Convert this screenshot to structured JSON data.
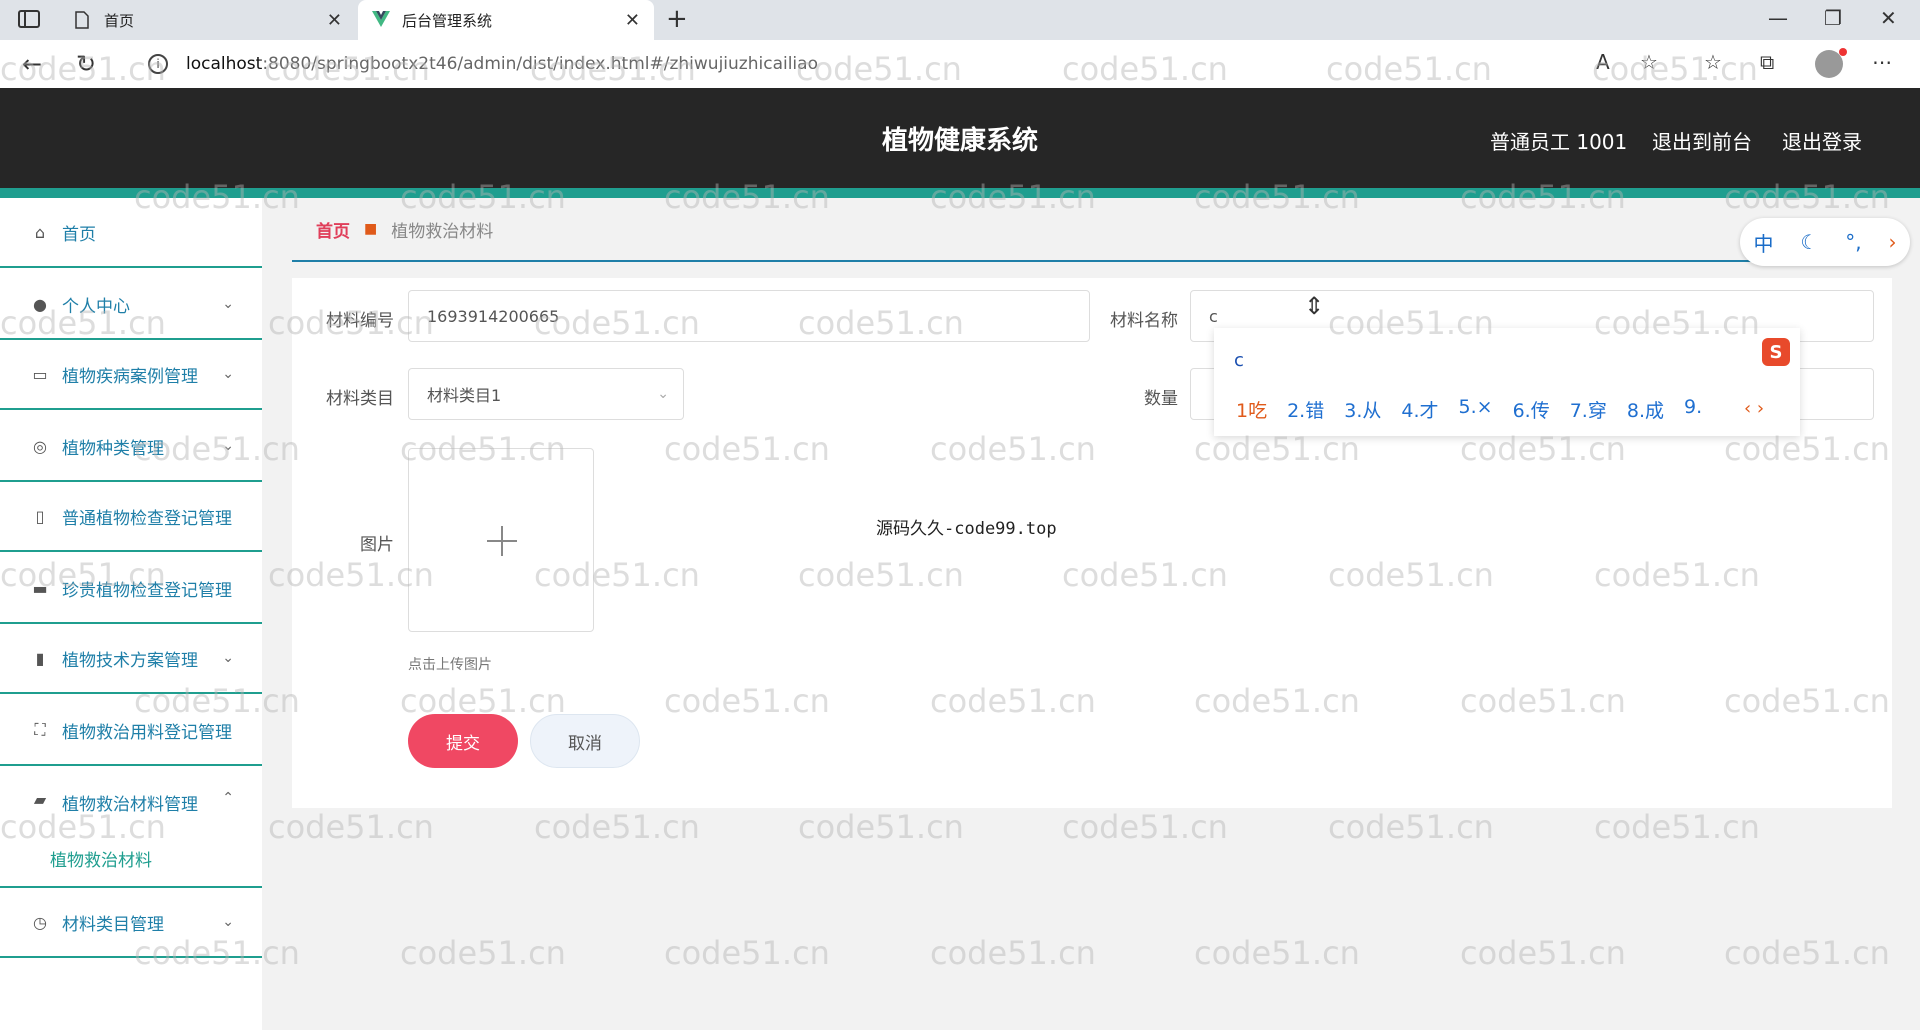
{
  "browser": {
    "tabs": [
      {
        "label": "首页",
        "icon": "document-icon"
      },
      {
        "label": "后台管理系统",
        "icon": "vue-logo-icon"
      }
    ],
    "url_host": "localhost",
    "url_path": ":8080/springbootx2t46/admin/dist/index.html#/zhiwujiuzhicailiao"
  },
  "header": {
    "title": "植物健康系统",
    "user": "普通员工 1001",
    "front_link": "退出到前台",
    "logout": "退出登录"
  },
  "sidebar": {
    "items": [
      {
        "label": "首页",
        "icon": "home-icon"
      },
      {
        "label": "个人中心",
        "icon": "user-icon"
      },
      {
        "label": "植物疾病案例管理",
        "icon": "message-icon"
      },
      {
        "label": "植物种类管理",
        "icon": "globe-icon"
      },
      {
        "label": "普通植物检查登记管理",
        "icon": "microphone-icon"
      },
      {
        "label": "珍贵植物检查登记管理",
        "icon": "folder-icon"
      },
      {
        "label": "植物技术方案管理",
        "icon": "bar-chart-icon"
      },
      {
        "label": "植物救治用料登记管理",
        "icon": "fullscreen-icon"
      },
      {
        "label": "植物救治材料管理",
        "icon": "briefcase-icon"
      },
      {
        "label": "材料类目管理",
        "icon": "compass-icon"
      }
    ],
    "sub_item": "植物救治材料"
  },
  "breadcrumb": {
    "home": "首页",
    "current": "植物救治材料"
  },
  "form": {
    "code_label": "材料编号",
    "code_value": "1693914200665",
    "name_label": "材料名称",
    "name_value": "c",
    "category_label": "材料类目",
    "category_value": "材料类目1",
    "quantity_label": "数量",
    "image_label": "图片",
    "upload_hint": "点击上传图片",
    "submit": "提交",
    "cancel": "取消"
  },
  "note": "源码久久-code99.top",
  "ime": {
    "input": "c",
    "candidates": [
      "1吃",
      "2.错",
      "3.从",
      "4.才",
      "5.×",
      "6.传",
      "7.穿",
      "8.成",
      "9."
    ]
  },
  "toolbar_bubble": {
    "lang": "中"
  },
  "watermark": "code51.cn"
}
